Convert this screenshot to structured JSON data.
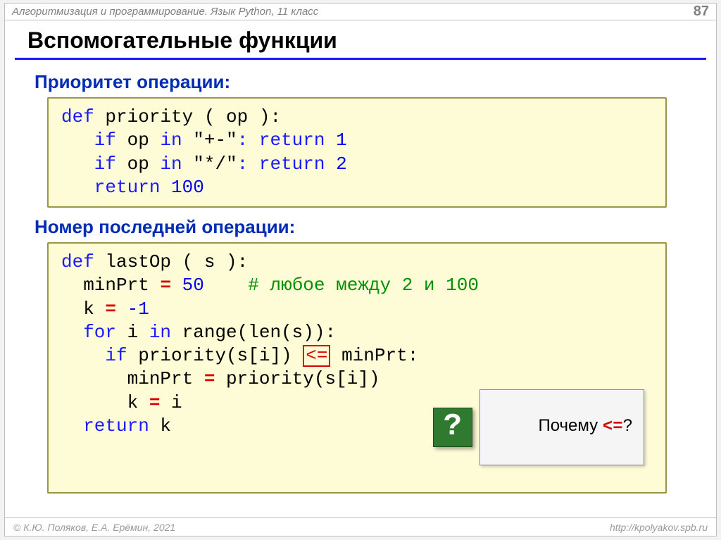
{
  "header": {
    "course": "Алгоритмизация и программирование. Язык Python, 11 класс",
    "page": "87"
  },
  "title": "Вспомогательные функции",
  "section1": {
    "heading": "Приоритет операции:"
  },
  "code1": {
    "l1_def": "def",
    "l1_rest": " priority ( op ):",
    "l2_if": "   if",
    "l2_mid": " op ",
    "l2_in": "in",
    "l2_str": " \"+-\"",
    "l2_ret": ": return",
    "l2_num": " 1",
    "l3_if": "   if",
    "l3_mid": " op ",
    "l3_in": "in",
    "l3_str": " \"*/\"",
    "l3_ret": ": return",
    "l3_num": " 2",
    "l4_ret": "   return",
    "l4_num": " 100"
  },
  "section2": {
    "heading": "Номер последней операции:"
  },
  "code2": {
    "l1_def": "def",
    "l1_rest": " lastOp ( s ):",
    "l2_a": "  minPrt ",
    "l2_eq": "=",
    "l2_num": " 50",
    "l2_sp": "    ",
    "l2_cmt": "# любое между 2 и 100",
    "l3_a": "  k ",
    "l3_eq": "= ",
    "l3_num": "-1",
    "l4_for": "  for",
    "l4_mid": " i ",
    "l4_in": "in",
    "l4_rest": " range(len(s)):",
    "l5_if": "    if",
    "l5_a": " priority(s[i]) ",
    "l5_op": "<=",
    "l5_b": " minPrt:",
    "l6_a": "      minPrt ",
    "l6_eq": "=",
    "l6_b": " priority(s[i])",
    "l7_a": "      k ",
    "l7_eq": "=",
    "l7_b": " i",
    "l8_ret": "  return",
    "l8_b": " k"
  },
  "callout": {
    "q": "?",
    "text_a": "Почему ",
    "text_op": "<=",
    "text_b": "?"
  },
  "footer": {
    "left": "© К.Ю. Поляков, Е.А. Ерёмин, 2021",
    "right": "http://kpolyakov.spb.ru"
  }
}
